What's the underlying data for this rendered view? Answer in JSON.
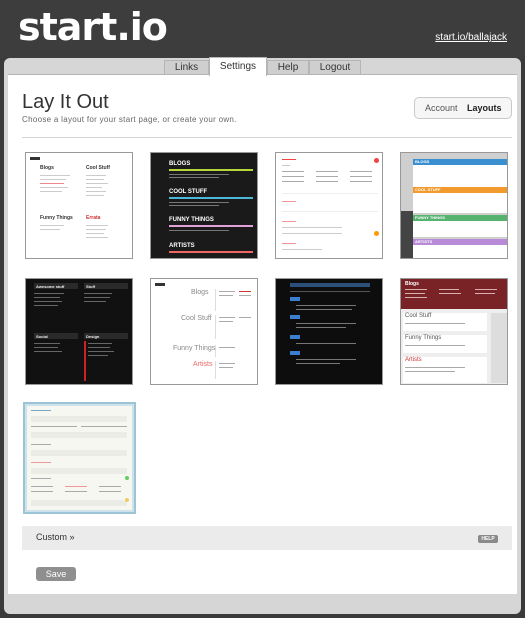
{
  "header": {
    "logo": "start.io",
    "user_link": "start.io/ballajack"
  },
  "tabs": [
    {
      "label": "Links"
    },
    {
      "label": "Settings"
    },
    {
      "label": "Help"
    },
    {
      "label": "Logout"
    }
  ],
  "main": {
    "title": "Lay It Out",
    "subtitle": "Choose a layout for your start page, or create your own.",
    "toggle": {
      "account": "Account",
      "layouts": "Layouts"
    },
    "layouts": [
      {
        "name": "layout-1",
        "headings": [
          "Blogs",
          "Cool Stuff",
          "Funny Things",
          "Errata"
        ]
      },
      {
        "name": "layout-2",
        "headings": [
          "BLOGS",
          "COOL STUFF",
          "FUNNY THINGS",
          "ARTISTS"
        ]
      },
      {
        "name": "layout-3"
      },
      {
        "name": "layout-4",
        "headings": [
          "BLOGS",
          "COOL STUFF",
          "FUNNY THINGS",
          "ARTISTS"
        ]
      },
      {
        "name": "layout-5",
        "headings": [
          "Awesome stuff",
          "Stuff",
          "Social",
          "Design"
        ]
      },
      {
        "name": "layout-6",
        "headings": [
          "Blogs",
          "Cool Stuff",
          "Funny Things",
          "Artists"
        ]
      },
      {
        "name": "layout-7"
      },
      {
        "name": "layout-8",
        "headings": [
          "Blogs",
          "Cool Stuff",
          "Funny Things",
          "Artists"
        ]
      },
      {
        "name": "layout-9"
      }
    ],
    "custom_label": "Custom »",
    "help_badge": "HELP",
    "save_label": "Save"
  },
  "colors": {
    "background": "#3d3d3d",
    "panel": "#ffffff",
    "selected_border": "#9bc4d6"
  }
}
